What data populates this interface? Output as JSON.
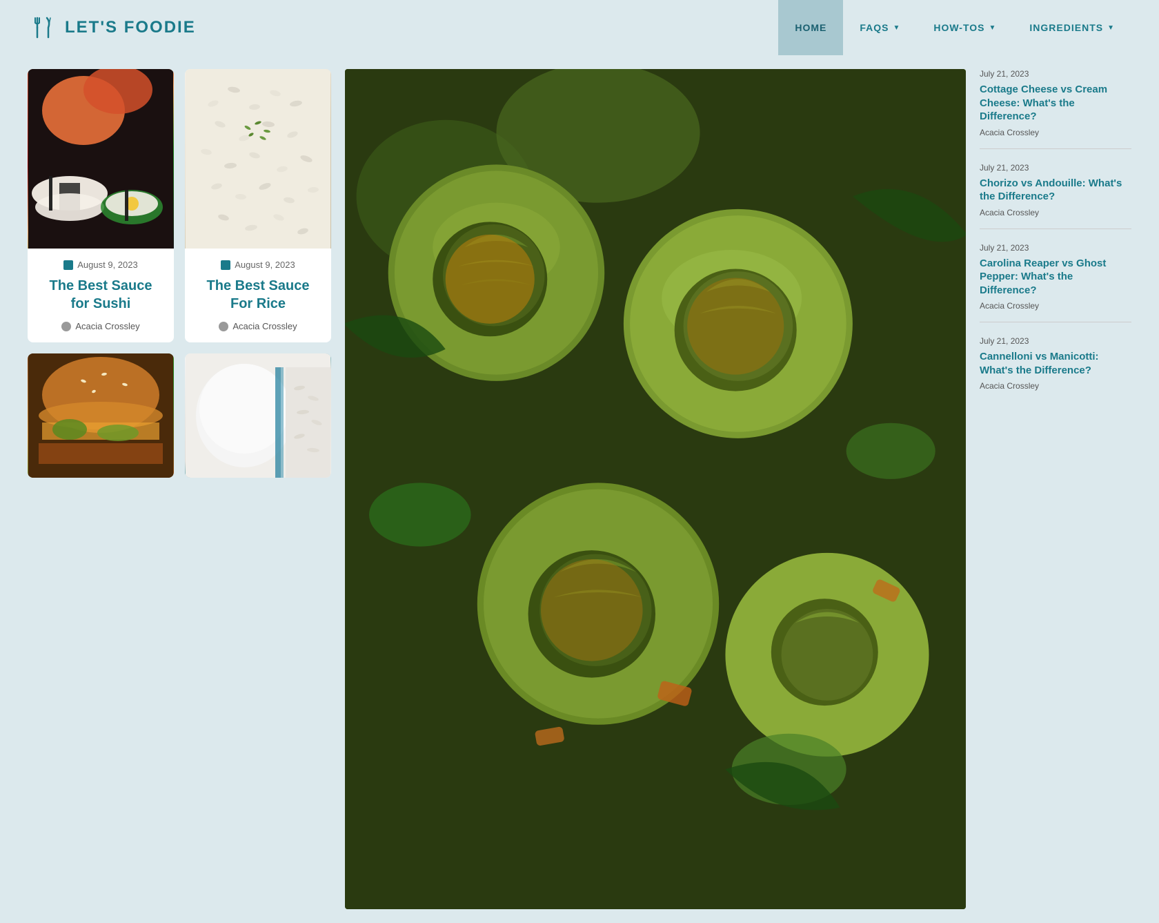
{
  "site": {
    "name": "LET'S FOODIE",
    "logo_alt": "Let's Foodie Logo"
  },
  "nav": {
    "items": [
      {
        "label": "HOME",
        "active": true,
        "has_dropdown": false
      },
      {
        "label": "FAQS",
        "active": false,
        "has_dropdown": true
      },
      {
        "label": "HOW-TOS",
        "active": false,
        "has_dropdown": true
      },
      {
        "label": "INGREDIENTS",
        "active": false,
        "has_dropdown": true
      }
    ]
  },
  "articles": {
    "card1": {
      "date": "August 9, 2023",
      "title": "The Best Sauce for Sushi",
      "author": "Acacia Crossley",
      "image_alt": "Sushi rolls"
    },
    "card2": {
      "date": "August 9, 2023",
      "title": "The Best Sauce For Rice",
      "author": "Acacia Crossley",
      "image_alt": "Rice with herbs"
    },
    "card3": {
      "image_alt": "Burger"
    },
    "card4": {
      "image_alt": "Rice dish"
    }
  },
  "sidebar": {
    "items": [
      {
        "date": "July 21, 2023",
        "title": "Cottage Cheese vs Cream Cheese: What's the Difference?",
        "author": "Acacia Crossley"
      },
      {
        "date": "July 21, 2023",
        "title": "Chorizo vs Andouille: What's the Difference?",
        "author": "Acacia Crossley"
      },
      {
        "date": "July 21, 2023",
        "title": "Carolina Reaper vs Ghost Pepper: What's the Difference?",
        "author": "Acacia Crossley"
      },
      {
        "date": "July 21, 2023",
        "title": "Cannelloni vs Manicotti: What's the Difference?",
        "author": "Acacia Crossley"
      }
    ]
  },
  "colors": {
    "teal": "#1a7a8a",
    "bg": "#dce9ed",
    "nav_active": "#a8c8d0"
  }
}
